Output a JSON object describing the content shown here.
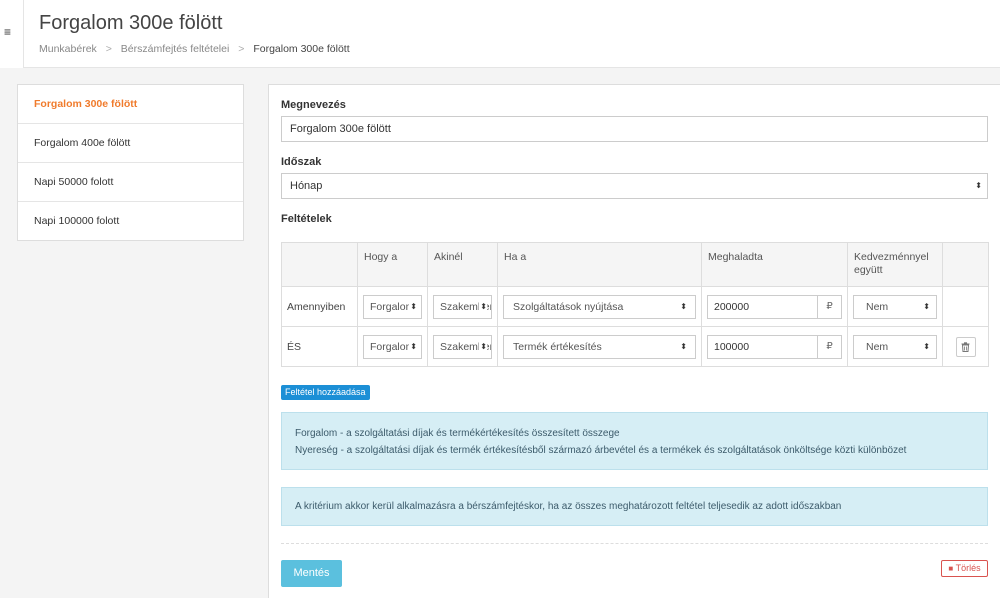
{
  "header": {
    "menu_icon": "≡",
    "title": "Forgalom 300e fölött",
    "breadcrumb": [
      "Munkabérek",
      "Bérszámfejtés feltételei",
      "Forgalom 300e fölött"
    ],
    "breadcrumb_separator": ">"
  },
  "rules_list": [
    {
      "label": "Forgalom 300e fölött",
      "active": true
    },
    {
      "label": "Forgalom 400e fölött",
      "active": false
    },
    {
      "label": "Napi 50000 folott",
      "active": false
    },
    {
      "label": "Napi 100000 folott",
      "active": false
    }
  ],
  "form": {
    "name_label": "Megnevezés",
    "name_value": "Forgalom 300e fölött",
    "period_label": "Időszak",
    "period_value": "Hónap",
    "conditions_label": "Feltételek",
    "table_headers": [
      "",
      "Hogy a",
      "Akinél",
      "Ha a",
      "Meghaladta",
      "Kedvezménnyel együtt",
      ""
    ],
    "rows": [
      {
        "connector": "Amennyiben",
        "hogy_a": "Forgalom",
        "akinel": "Szakember",
        "ha_a": "Szolgáltatások nyújtása",
        "amount": "200000",
        "currency": "₽",
        "kedvezmeny": "Nem",
        "deletable": false
      },
      {
        "connector": "ÉS",
        "hogy_a": "Forgalom",
        "akinel": "Szakember",
        "ha_a": "Termék értékesítés",
        "amount": "100000",
        "currency": "₽",
        "kedvezmeny": "Nem",
        "deletable": true
      }
    ],
    "add_condition_label": "Feltétel hozzáadása",
    "info_lines": [
      "Forgalom - a szolgáltatási díjak és termékértékesítés összesített összege",
      "Nyereség - a szolgáltatási díjak és termék értékesítésből származó árbevétel és a termékek és szolgáltatások önköltsége közti különbözet"
    ],
    "criteria_note": "A kritérium akkor kerül alkalmazásra a bérszámfejtéskor, ha az összes meghatározott feltétel teljesedik az adott időszakban",
    "save_label": "Mentés",
    "delete_label": "Törlés",
    "select_arrow": "⬍",
    "trash_icon": "🗑"
  },
  "colors": {
    "active_item": "#f07b2c",
    "add_button": "#1c8fd6",
    "save_button": "#5bc0de",
    "delete_button": "#d9534f",
    "info_box": "#d6eef5"
  }
}
